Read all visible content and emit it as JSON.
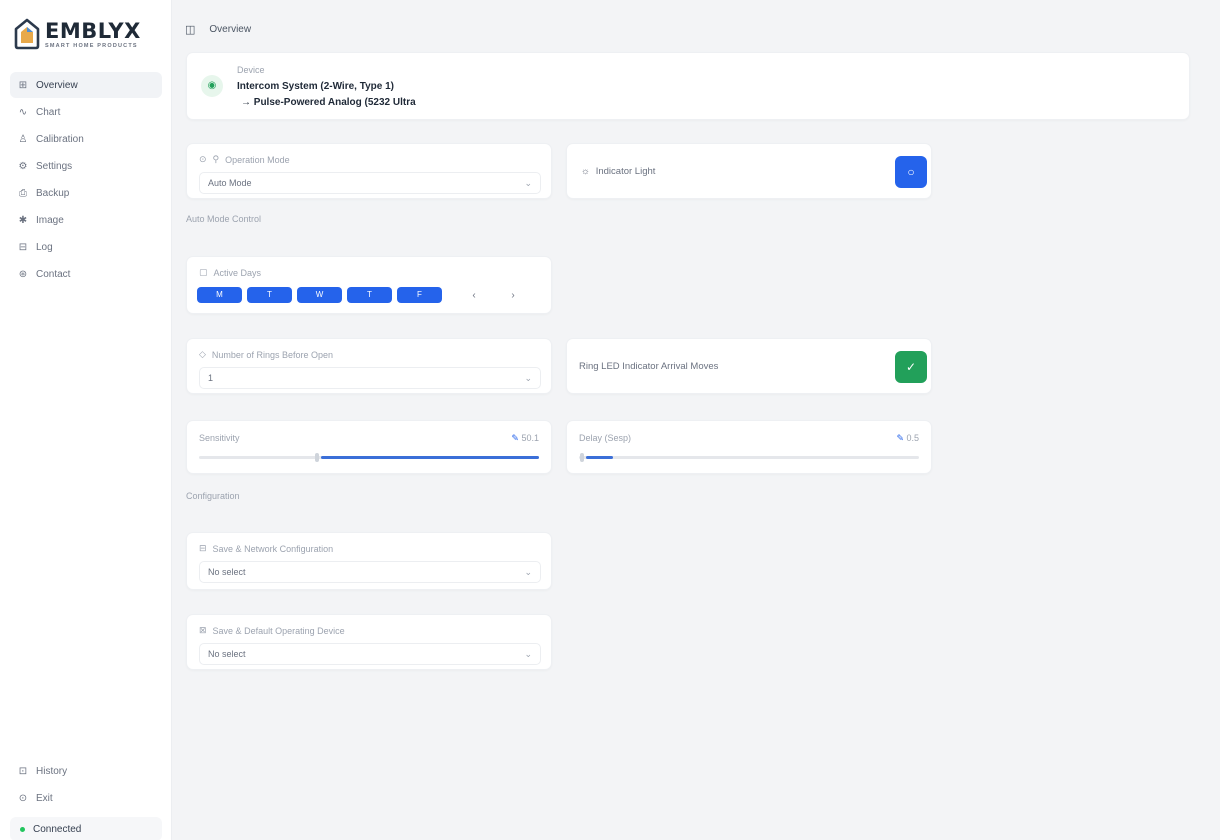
{
  "brand": {
    "name": "EMBLYX",
    "tagline": "SMART HOME PRODUCTS"
  },
  "sidebar": {
    "items": [
      {
        "label": "Overview",
        "icon": "grid-icon",
        "glyph": "⊞",
        "active": true
      },
      {
        "label": "Chart",
        "icon": "chart-icon",
        "glyph": "∿",
        "active": false
      },
      {
        "label": "Calibration",
        "icon": "calibration-icon",
        "glyph": "♙",
        "active": false
      },
      {
        "label": "Settings",
        "icon": "settings-icon",
        "glyph": "⚙",
        "active": false
      },
      {
        "label": "Backup",
        "icon": "backup-icon",
        "glyph": "⎙",
        "active": false
      },
      {
        "label": "Image",
        "icon": "image-icon",
        "glyph": "✱",
        "active": false
      },
      {
        "label": "Log",
        "icon": "log-icon",
        "glyph": "⊟",
        "active": false
      },
      {
        "label": "Contact",
        "icon": "contact-icon",
        "glyph": "⊛",
        "active": false
      }
    ],
    "bottom": [
      {
        "label": "History",
        "icon": "history-icon",
        "glyph": "⊡"
      },
      {
        "label": "Exit",
        "icon": "exit-icon",
        "glyph": "⊙"
      }
    ],
    "status": {
      "label": "Connected",
      "color": "#22c55e"
    }
  },
  "topbar": {
    "title": "Overview"
  },
  "device": {
    "label": "Device",
    "line1": "Intercom System (2-Wire, Type 1)",
    "line2": "→ Pulse-Powered Analog (5232 Ultra"
  },
  "operation_mode": {
    "label": "Operation Mode",
    "value": "Auto Mode"
  },
  "indicator_light": {
    "label": "Indicator Light",
    "button_color": "#2563eb"
  },
  "auto_mode_section": "Auto Mode Control",
  "active_days": {
    "label": "Active Days",
    "chips": [
      "M",
      "T",
      "W",
      "T",
      "F"
    ],
    "prev": "‹",
    "next": "›"
  },
  "number_of_rings": {
    "label": "Number of Rings Before Open",
    "value": "1"
  },
  "led_toggle": {
    "label": "Ring LED Indicator Arrival Moves",
    "button_color": "#22a05a"
  },
  "sensitivity": {
    "label": "Sensitivity",
    "value": "50.1",
    "fill_start": 0.36,
    "fill_end": 1.0
  },
  "delay": {
    "label": "Delay (Sesp)",
    "value": "0.5",
    "fill_start": 0.02,
    "fill_end": 0.1
  },
  "config_section": "Configuration",
  "network_config": {
    "label": "Save & Network Configuration",
    "value": "No select"
  },
  "device_restore": {
    "label": "Save & Default Operating Device",
    "value": "No select"
  },
  "colors": {
    "accent": "#2563eb",
    "success": "#22a05a"
  }
}
